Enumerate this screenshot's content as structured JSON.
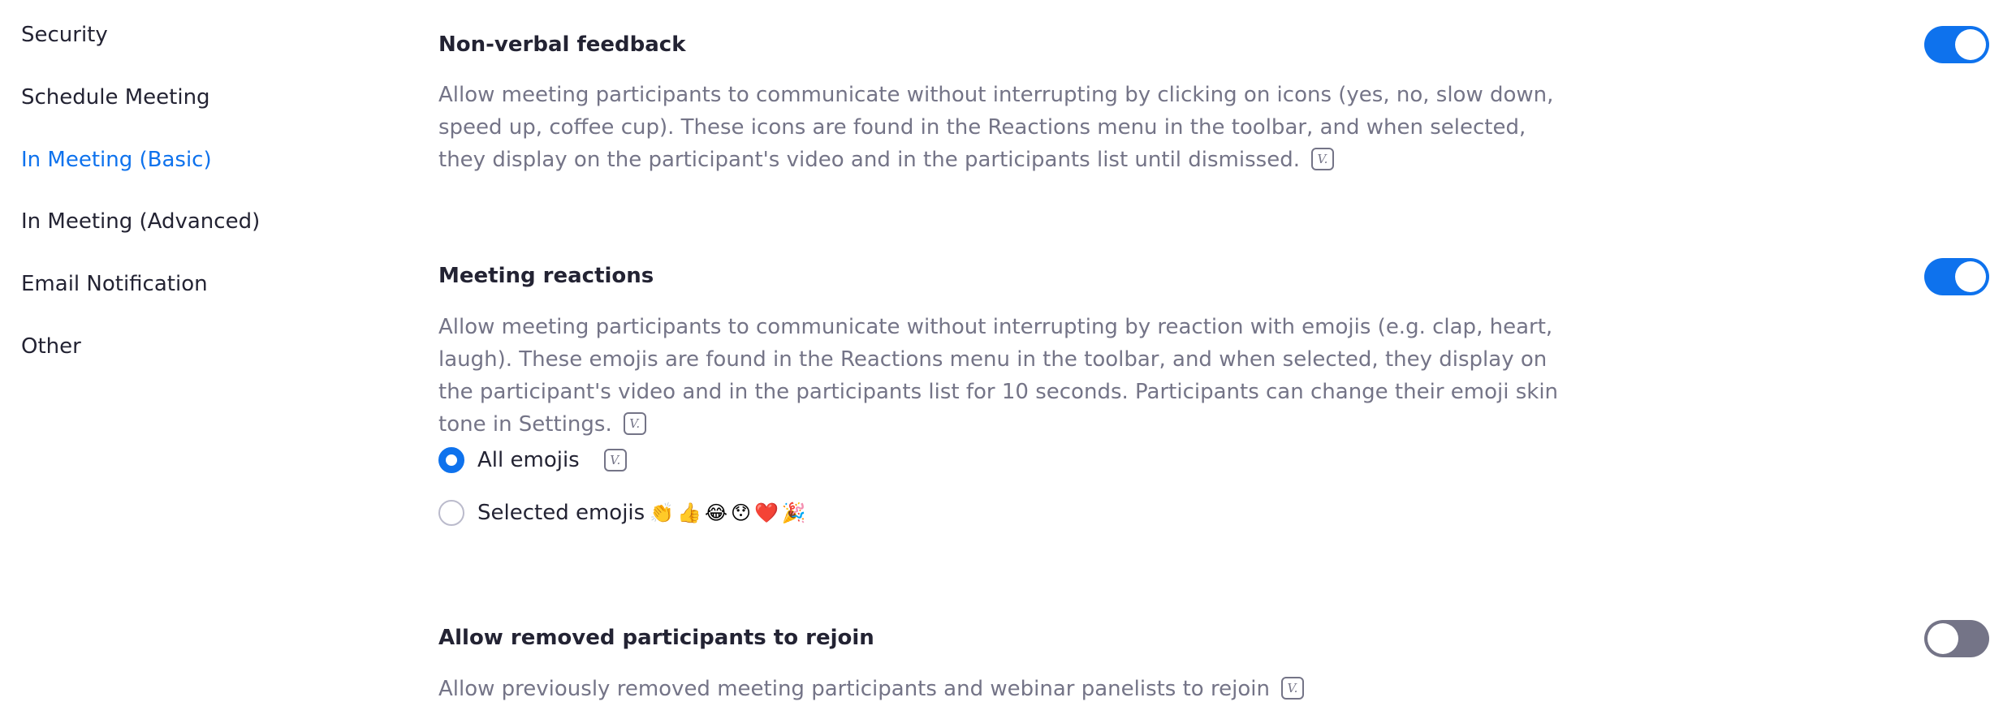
{
  "sidebar": {
    "items": [
      {
        "label": "Security",
        "active": false
      },
      {
        "label": "Schedule Meeting",
        "active": false
      },
      {
        "label": "In Meeting (Basic)",
        "active": true
      },
      {
        "label": "In Meeting (Advanced)",
        "active": false
      },
      {
        "label": "Email Notification",
        "active": false
      },
      {
        "label": "Other",
        "active": false
      }
    ]
  },
  "settings": [
    {
      "title": "Non-verbal feedback",
      "description": "Allow meeting participants to communicate without interrupting by clicking on icons (yes, no, slow down, speed up, coffee cup). These icons are found in the Reactions menu in the toolbar, and when selected, they display on the participant's video and in the participants list until dismissed.",
      "version_icon": "V.",
      "enabled": true
    },
    {
      "title": "Meeting reactions",
      "description": "Allow meeting participants to communicate without interrupting by reaction with emojis (e.g. clap, heart, laugh). These emojis are found in the Reactions menu in the toolbar, and when selected, they display on the participant's video and in the participants list for 10 seconds. Participants can change their emoji skin tone in Settings.",
      "version_icon": "V.",
      "enabled": true,
      "options": [
        {
          "label": "All emojis",
          "checked": true,
          "version_icon": "V."
        },
        {
          "label": "Selected emojis",
          "checked": false,
          "emojis": "👏👍😂😯❤️🎉"
        }
      ]
    },
    {
      "title": "Allow removed participants to rejoin",
      "description": "Allow previously removed meeting participants and webinar panelists to rejoin",
      "version_icon": "V.",
      "enabled": false
    }
  ],
  "colors": {
    "accent": "#0e72ed",
    "text_primary": "#232333",
    "text_secondary": "#747487",
    "toggle_off": "#747487"
  }
}
